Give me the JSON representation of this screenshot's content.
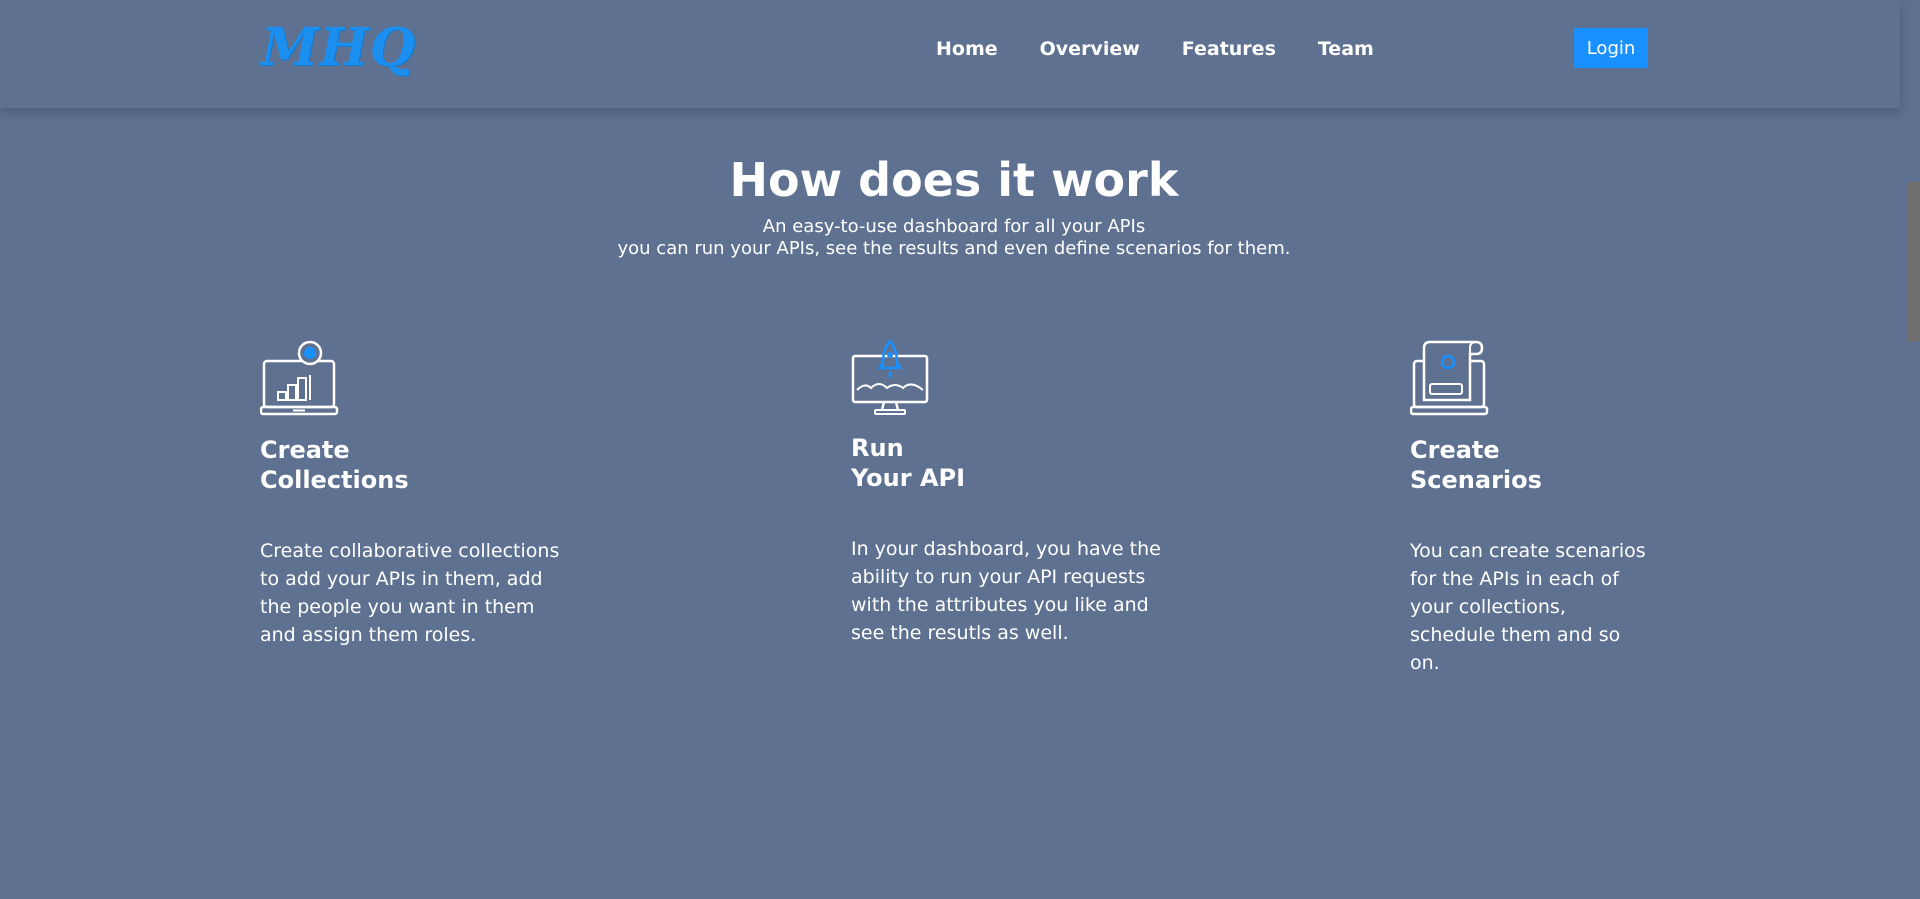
{
  "header": {
    "logo": "MHQ",
    "nav": [
      "Home",
      "Overview",
      "Features",
      "Team"
    ],
    "login_label": "Login"
  },
  "section": {
    "title": "How does it work",
    "subtitle_line1": "An easy-to-use dashboard for all your APIs",
    "subtitle_line2": "you can run your APIs, see the results and even define scenarios for them."
  },
  "features": [
    {
      "icon": "laptop-chart-icon",
      "title_line1": "Create",
      "title_line2": "Collections",
      "desc": [
        "Create collaborative collections",
        "to add your APIs in them, add",
        "the people you want in them",
        "and assign them roles."
      ]
    },
    {
      "icon": "monitor-rocket-icon",
      "title_line1": "Run",
      "title_line2": "Your API",
      "desc": [
        "In your dashboard, you have the",
        "ability to run your API requests",
        "with the attributes you like and",
        "see the resutls as well."
      ]
    },
    {
      "icon": "laptop-scroll-icon",
      "title_line1": "Create",
      "title_line2": "Scenarios",
      "desc": [
        "You can create scenarios",
        "for the APIs in each of",
        "your collections,",
        "schedule them and so",
        "on."
      ]
    }
  ],
  "colors": {
    "background": "#5f7191",
    "accent": "#1890ff",
    "text": "#ffffff",
    "scrollbar_thumb": "#6e6e6e"
  }
}
